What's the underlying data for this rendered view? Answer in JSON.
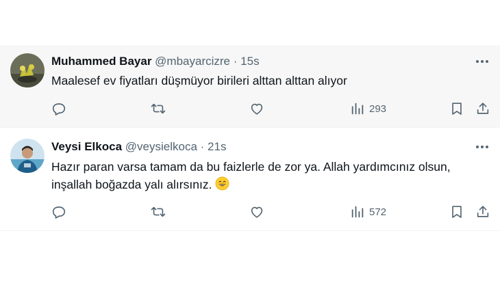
{
  "tweets": [
    {
      "name": "Muhammed Bayar",
      "handle": "@mbayarcizre",
      "separator": "·",
      "time": "15s",
      "text": "Maalesef ev fiyatları düşmüyor birileri alttan alttan alıyor",
      "views": "293"
    },
    {
      "name": "Veysi Elkoca",
      "handle": "@veysielkoca",
      "separator": "·",
      "time": "21s",
      "text_line1": "Hazır paran varsa tamam da bu faizlerle de zor ya. Allah yardımcınız olsun,",
      "text_line2": "inşallah boğazda yalı alırsınız.",
      "views": "572"
    }
  ],
  "icons": {
    "reply": "reply-icon",
    "retweet": "retweet-icon",
    "like": "heart-icon",
    "views": "views-icon",
    "bookmark": "bookmark-icon",
    "share": "share-icon",
    "more": "more-icon"
  },
  "colors": {
    "text": "#0f1419",
    "muted": "#536471",
    "hover_bg": "#f7f7f7",
    "divider": "#eff3f4"
  }
}
